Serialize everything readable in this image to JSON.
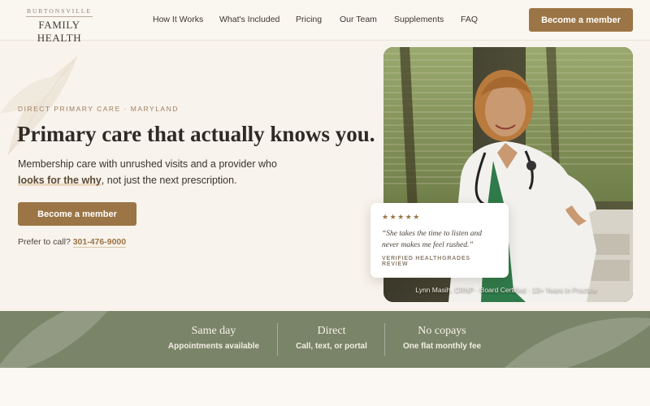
{
  "brand": {
    "top": "BURTONSVILLE",
    "bottom": "FAMILY HEALTH"
  },
  "nav": {
    "items": [
      {
        "label": "How It Works"
      },
      {
        "label": "What's Included"
      },
      {
        "label": "Pricing"
      },
      {
        "label": "Our Team"
      },
      {
        "label": "Supplements"
      },
      {
        "label": "FAQ"
      }
    ],
    "cta": "Become a member"
  },
  "hero": {
    "eyebrow": "DIRECT PRIMARY CARE · MARYLAND",
    "headline": "Primary care that actually knows you.",
    "sub_before": "Membership care with unrushed visits and a provider who",
    "sub_emph": "looks for the why",
    "sub_after": ", not just the next prescription.",
    "cta": "Become a member",
    "call_prefix": "Prefer to call?",
    "phone": "301-476-9000"
  },
  "photo": {
    "caption": "Lynn Masih, CRNP · Board Certified · 13+ Years in Practice"
  },
  "review": {
    "stars": "★★★★★",
    "rating": 5,
    "quote": "“She takes the time to listen and never makes me feel rushed.”",
    "source": "VERIFIED HEALTHGRADES REVIEW"
  },
  "stats": [
    {
      "title": "Same day",
      "sub": "Appointments available"
    },
    {
      "title": "Direct",
      "sub": "Call, text, or portal"
    },
    {
      "title": "No copays",
      "sub": "One flat monthly fee"
    }
  ],
  "colors": {
    "accent": "#9b7545",
    "band": "#7a8468",
    "background": "#f8f3ec"
  }
}
